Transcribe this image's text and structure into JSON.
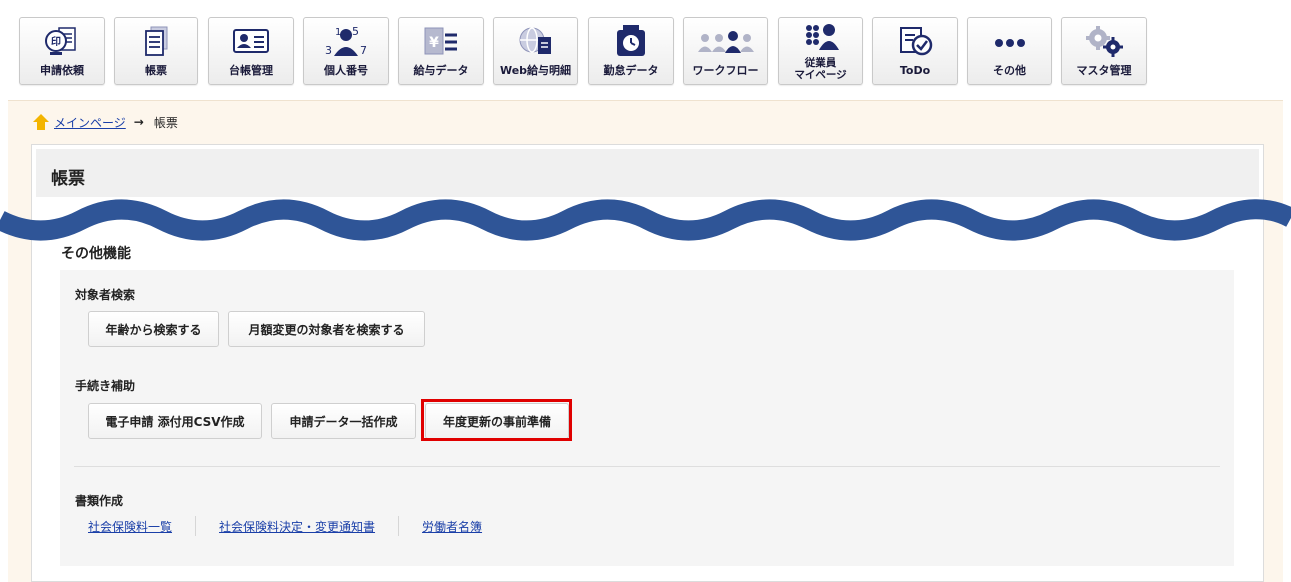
{
  "toolbar": {
    "items": [
      {
        "label": "申請依頼",
        "icon": "stamp-document-icon"
      },
      {
        "label": "帳票",
        "icon": "document-list-icon"
      },
      {
        "label": "台帳管理",
        "icon": "id-card-icon"
      },
      {
        "label": "個人番号",
        "icon": "person-number-icon"
      },
      {
        "label": "給与データ",
        "icon": "yen-list-icon"
      },
      {
        "label": "Web給与明細",
        "icon": "globe-document-icon"
      },
      {
        "label": "勤怠データ",
        "icon": "timecard-clock-icon"
      },
      {
        "label": "ワークフロー",
        "icon": "workflow-people-icon"
      },
      {
        "label": "従業員\nマイページ",
        "icon": "employee-mypage-icon"
      },
      {
        "label": "ToDo",
        "icon": "todo-check-icon"
      },
      {
        "label": "その他",
        "icon": "more-dots-icon"
      },
      {
        "label": "マスタ管理",
        "icon": "gears-icon"
      }
    ]
  },
  "breadcrumb": {
    "home": "メインページ",
    "separator": "→",
    "current": "帳票"
  },
  "page": {
    "title": "帳票"
  },
  "other_functions": {
    "title": "その他機能",
    "search": {
      "title": "対象者検索",
      "buttons": [
        "年齢から検索する",
        "月額変更の対象者を検索する"
      ]
    },
    "assist": {
      "title": "手続き補助",
      "buttons": [
        "電子申請 添付用CSV作成",
        "申請データ一括作成",
        "年度更新の事前準備"
      ]
    },
    "documents": {
      "title": "書類作成",
      "links": [
        "社会保険料一覧",
        "社会保険料決定・変更通知書",
        "労働者名簿"
      ]
    }
  },
  "colors": {
    "highlight": "#e00000",
    "wave": "#2f5597",
    "link": "#1a3fa8",
    "icon": "#1f2a6b"
  }
}
